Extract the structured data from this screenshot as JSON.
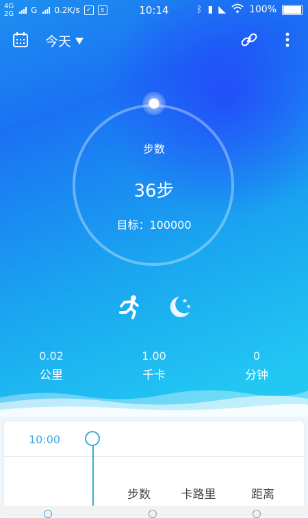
{
  "status_bar": {
    "net1": "4G",
    "net2": "2G",
    "carrier": "G",
    "speed": "0.2K/s",
    "time": "10:14",
    "battery": "100%"
  },
  "header": {
    "date": "今天"
  },
  "ring": {
    "title": "步数",
    "value": "36步",
    "goal": "目标：100000"
  },
  "stats": [
    {
      "value": "0.02",
      "label": "公里"
    },
    {
      "value": "1.00",
      "label": "千卡"
    },
    {
      "value": "0",
      "label": "分钟"
    }
  ],
  "timeline": {
    "time": "10:00",
    "columns": [
      "步数",
      "卡路里",
      "距离"
    ]
  },
  "colors": {
    "accent": "#3aa9e4",
    "gradient_top": "#1a72f3",
    "gradient_bottom": "#22c8f2"
  },
  "icons": [
    "calendar-icon",
    "link-icon",
    "more-icon",
    "run-icon",
    "sleep-icon"
  ]
}
